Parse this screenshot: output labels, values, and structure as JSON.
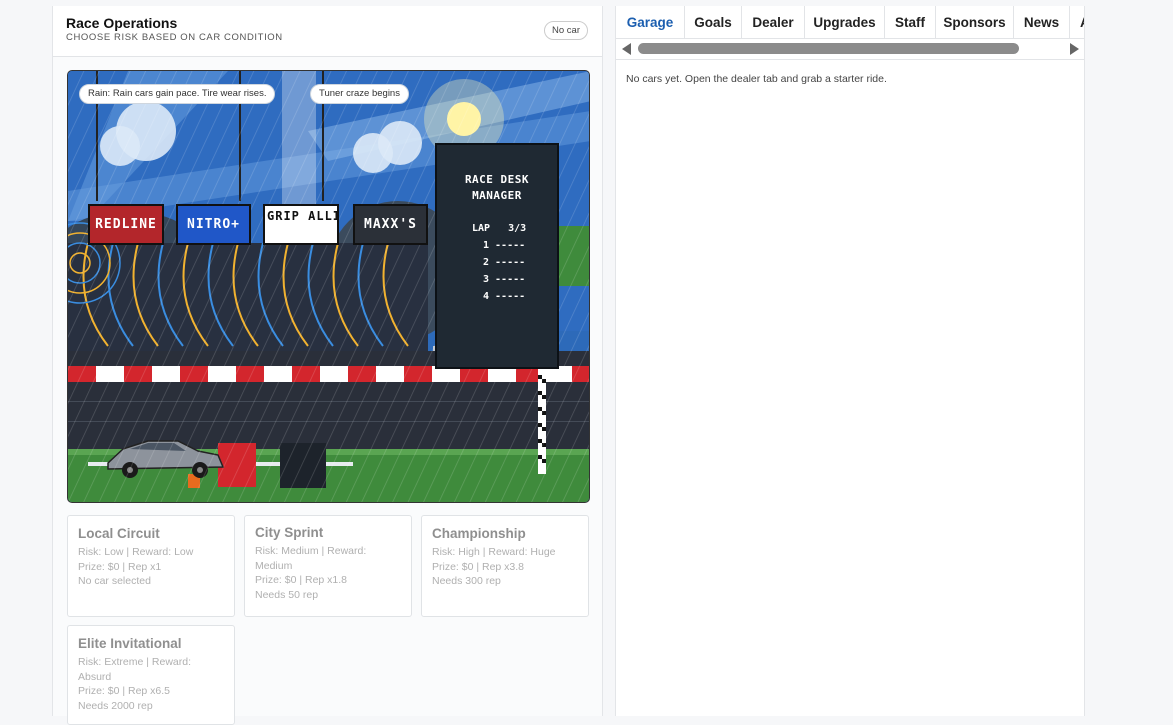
{
  "ops": {
    "title": "Race Operations",
    "subtitle": "CHOOSE RISK BASED ON CAR CONDITION",
    "car_status": "No car"
  },
  "scene": {
    "weather_chip": "Rain: Rain cars gain pace. Tire wear rises.",
    "event_chip": "Tuner craze begins",
    "sponsors": [
      {
        "label": "REDLINE",
        "color": "#b3262b"
      },
      {
        "label": "NITRO+",
        "color": "#2057c8"
      },
      {
        "label": "GRIP ALLIANCE",
        "color": "#ffffff"
      },
      {
        "label": "MAXX'S",
        "color": "#2b3038"
      }
    ],
    "desk": {
      "title_line1": "RACE DESK",
      "title_line2": "MANAGER",
      "lap_label": "LAP",
      "lap_value": "3/3",
      "positions": [
        "1 -----",
        "2 -----",
        "3 -----",
        "4 -----"
      ]
    }
  },
  "races": [
    {
      "title": "Local Circuit",
      "lines": [
        "Risk: Low | Reward: Low",
        "Prize: $0 | Rep x1",
        "No car selected"
      ]
    },
    {
      "title": "City Sprint",
      "lines": [
        "Risk: Medium | Reward:",
        "Medium",
        "Prize: $0 | Rep x1.8",
        "Needs 50 rep"
      ]
    },
    {
      "title": "Championship",
      "lines": [
        "Risk: High | Reward: Huge",
        "Prize: $0 | Rep x3.8",
        "Needs 300 rep"
      ]
    },
    {
      "title": "Elite Invitational",
      "lines": [
        "Risk: Extreme | Reward:",
        "Absurd",
        "Prize: $0 | Rep x6.5",
        "Needs 2000 rep"
      ]
    }
  ],
  "tabs": [
    "Garage",
    "Goals",
    "Dealer",
    "Upgrades",
    "Staff",
    "Sponsors",
    "News",
    "A"
  ],
  "active_tab": "Garage",
  "garage": {
    "empty_message": "No cars yet. Open the dealer tab and grab a starter ride."
  },
  "colors": {
    "active_tab": "#1c5fb0",
    "sky": "#2d6ab9",
    "grass": "#3f8b3c"
  }
}
